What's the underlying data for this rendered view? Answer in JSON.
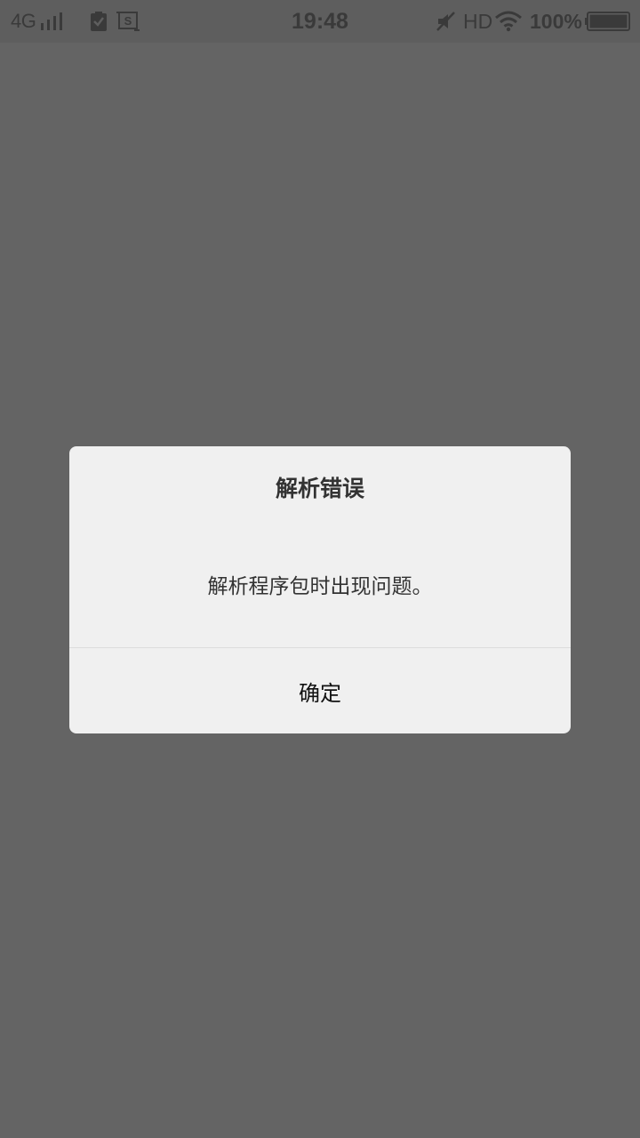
{
  "status_bar": {
    "network": "4G",
    "time": "19:48",
    "hd": "HD",
    "battery_percent": "100%",
    "battery_level": 1.0,
    "icons": [
      "signal-icon",
      "check-clipboard-icon",
      "screenshot-s-icon",
      "mute-icon",
      "wifi-icon",
      "battery-icon"
    ]
  },
  "dialog": {
    "title": "解析错误",
    "message": "解析程序包时出现问题。",
    "confirm_label": "确定"
  },
  "colors": {
    "overlay": "#646464",
    "dialog_bg": "#f0f0f0",
    "text": "#333333",
    "status_fg": "#3a3a3a"
  }
}
